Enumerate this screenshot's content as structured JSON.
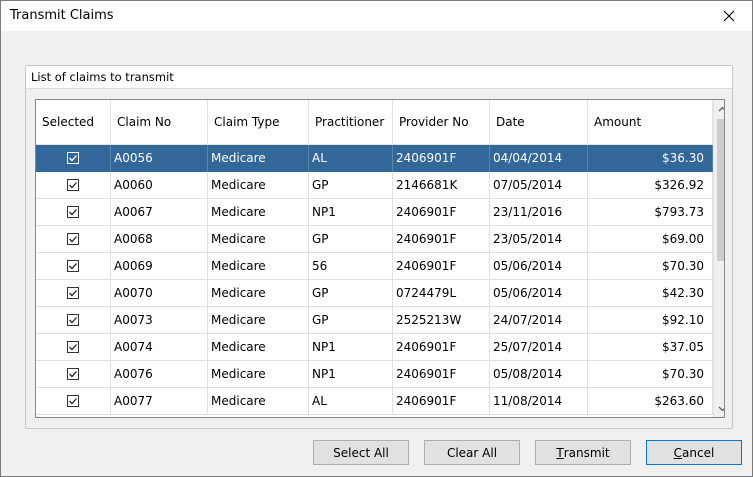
{
  "window": {
    "title": "Transmit Claims"
  },
  "group": {
    "title": "List of claims to transmit"
  },
  "columns": [
    "Selected",
    "Claim No",
    "Claim Type",
    "Practitioner",
    "Provider No",
    "Date",
    "Amount"
  ],
  "rows": [
    {
      "selected": true,
      "claim_no": "A0056",
      "claim_type": "Medicare",
      "practitioner": "AL",
      "provider_no": "2406901F",
      "date": "04/04/2014",
      "amount": "$36.30",
      "highlighted": true
    },
    {
      "selected": true,
      "claim_no": "A0060",
      "claim_type": "Medicare",
      "practitioner": "GP",
      "provider_no": "2146681K",
      "date": "07/05/2014",
      "amount": "$326.92"
    },
    {
      "selected": true,
      "claim_no": "A0067",
      "claim_type": "Medicare",
      "practitioner": "NP1",
      "provider_no": "2406901F",
      "date": "23/11/2016",
      "amount": "$793.73"
    },
    {
      "selected": true,
      "claim_no": "A0068",
      "claim_type": "Medicare",
      "practitioner": "GP",
      "provider_no": "2406901F",
      "date": "23/05/2014",
      "amount": "$69.00"
    },
    {
      "selected": true,
      "claim_no": "A0069",
      "claim_type": "Medicare",
      "practitioner": "56",
      "provider_no": "2406901F",
      "date": "05/06/2014",
      "amount": "$70.30"
    },
    {
      "selected": true,
      "claim_no": "A0070",
      "claim_type": "Medicare",
      "practitioner": "GP",
      "provider_no": "0724479L",
      "date": "05/06/2014",
      "amount": "$42.30"
    },
    {
      "selected": true,
      "claim_no": "A0073",
      "claim_type": "Medicare",
      "practitioner": "GP",
      "provider_no": "2525213W",
      "date": "24/07/2014",
      "amount": "$92.10"
    },
    {
      "selected": true,
      "claim_no": "A0074",
      "claim_type": "Medicare",
      "practitioner": "NP1",
      "provider_no": "2406901F",
      "date": "25/07/2014",
      "amount": "$37.05"
    },
    {
      "selected": true,
      "claim_no": "A0076",
      "claim_type": "Medicare",
      "practitioner": "NP1",
      "provider_no": "2406901F",
      "date": "05/08/2014",
      "amount": "$70.30"
    },
    {
      "selected": true,
      "claim_no": "A0077",
      "claim_type": "Medicare",
      "practitioner": "AL",
      "provider_no": "2406901F",
      "date": "11/08/2014",
      "amount": "$263.60"
    }
  ],
  "buttons": {
    "select_all": "Select All",
    "clear_all": "Clear All",
    "transmit_mnemonic": "T",
    "transmit_rest": "ransmit",
    "cancel_mnemonic": "C",
    "cancel_rest": "ancel"
  },
  "colors": {
    "selection": "#336699",
    "window_bg": "#f0f0f0",
    "button_bg": "#e1e1e1"
  },
  "icons": {
    "close": "close-icon",
    "scroll_up": "chevron-up-icon",
    "scroll_down": "chevron-down-icon",
    "checkbox": "checkmark-icon"
  }
}
